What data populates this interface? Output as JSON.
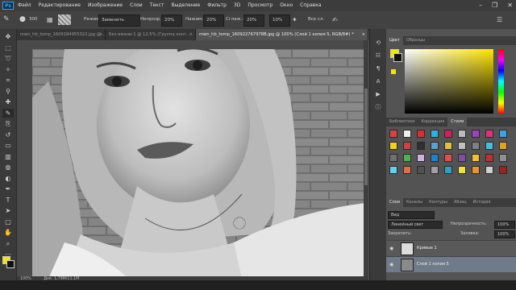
{
  "menubar": {
    "logo": "Ps",
    "items": [
      "Файл",
      "Редактирование",
      "Изображение",
      "Слои",
      "Текст",
      "Выделение",
      "Фильтр",
      "3D",
      "Просмотр",
      "Окно",
      "Справка"
    ],
    "window_controls": [
      "–",
      "❐",
      "✕"
    ]
  },
  "optionsbar": {
    "brush_size": "300",
    "mode_label": "Режим:",
    "mode_value": "Заменить",
    "opacity_label": "Непрозр.:",
    "opacity_value": "20%",
    "flow_label": "Нажим:",
    "flow_value": "20%",
    "smooth_label": "Сглаж.:",
    "smooth_value": "20%",
    "angle_value": "10%",
    "all_layers": "Все сл."
  },
  "tabs": [
    {
      "label": "mwn_hb_tomp_1609184955322.jpg @...",
      "active": false
    },
    {
      "label": "Без имени-1 @ 12,5% (Группа конт...",
      "active": false
    },
    {
      "label": "mwn_hb_tomp_160922767978B.jpg @ 100% (Слой 1 копия 5, RGB/8#) *",
      "active": true
    }
  ],
  "status": {
    "zoom": "100%",
    "doc": "Док: 1,79М/11,1М"
  },
  "color_panel": {
    "tabs": [
      "Цвет",
      "Образцы"
    ],
    "fg": "#f2e600",
    "bg": "#111111"
  },
  "swatch_panel": {
    "tabs": [
      "Библиотеки",
      "Коррекция",
      "Стили"
    ],
    "colors": [
      "#e04040",
      "#eeeeee",
      "#d83030",
      "#30b0e0",
      "#d02060",
      "#bcbcbc",
      "#a040c0",
      "#e03080",
      "#40a0e0",
      "#f0d020",
      "#d04040",
      "#303030",
      "#5aa0d0",
      "#e0c040",
      "#c0c0c0",
      "#808080",
      "#40c0e0",
      "#e0a020",
      "#707070",
      "#50b050",
      "#d0b0e0",
      "#2080d0",
      "#e05050",
      "#8050a0",
      "#f0c030",
      "#c03030",
      "#909090",
      "#60d0f0",
      "#e07040",
      "#505050",
      "#a0a0a0",
      "#30a0c0",
      "#f0e040",
      "#f09030",
      "#d0d0d0",
      "#a02020"
    ]
  },
  "layers_panel": {
    "tabs": [
      "Слои",
      "Каналы",
      "Контуры",
      "Абзац",
      "История"
    ],
    "filter_label": "Вид",
    "blend_mode": "Линейный свет",
    "opacity_label": "Непрозрачность:",
    "opacity_value": "100%",
    "lock_label": "Закрепить:",
    "fill_label": "Заливка:",
    "fill_value": "100%",
    "layers": [
      {
        "name": "Кривые 1",
        "selected": false
      },
      {
        "name": "Слой 1 копия 5",
        "selected": true
      }
    ]
  }
}
